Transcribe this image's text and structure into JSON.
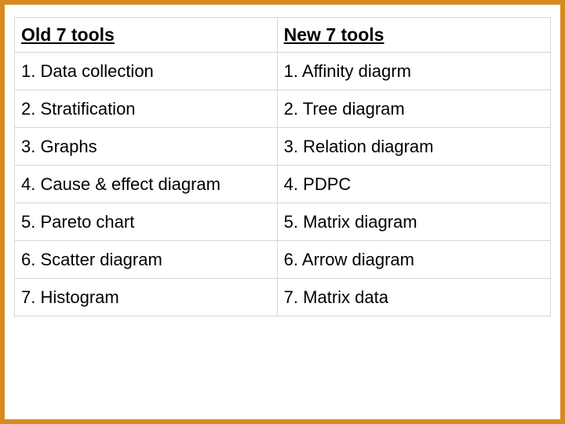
{
  "headers": {
    "old": "Old 7 tools",
    "new": "New 7 tools"
  },
  "rows": [
    {
      "n": "1.",
      "old": "Data collection",
      "new": "Affinity diagrm"
    },
    {
      "n": "2.",
      "old": "Stratification",
      "new": "Tree diagram"
    },
    {
      "n": "3.",
      "old": "Graphs",
      "new": "Relation diagram"
    },
    {
      "n": "4.",
      "old": "Cause & effect diagram",
      "new": "PDPC"
    },
    {
      "n": "5.",
      "old": "Pareto chart",
      "new": "Matrix diagram"
    },
    {
      "n": "6.",
      "old": "Scatter diagram",
      "new": "Arrow diagram"
    },
    {
      "n": "7.",
      "old": "Histogram",
      "new": "Matrix data"
    }
  ]
}
